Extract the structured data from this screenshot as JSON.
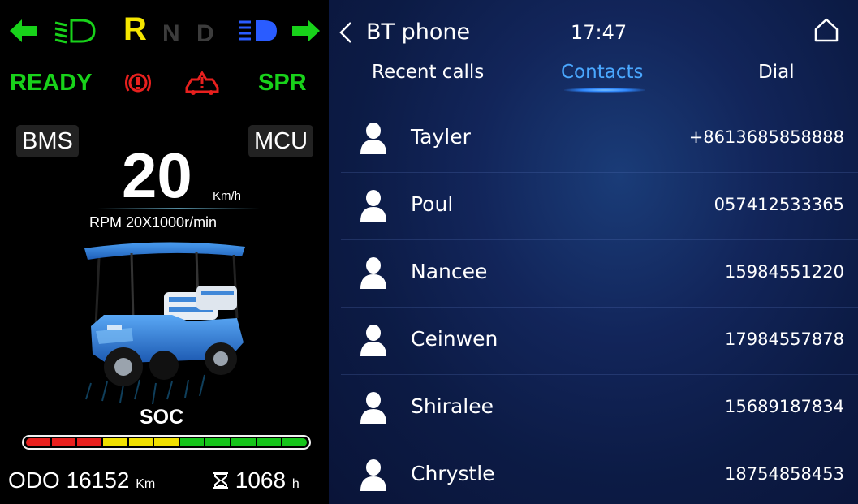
{
  "cluster": {
    "gears": {
      "r": "R",
      "n": "N",
      "d": "D"
    },
    "status": {
      "ready": "READY",
      "spr": "SPR"
    },
    "tags": {
      "bms": "BMS",
      "mcu": "MCU"
    },
    "speed": {
      "value": "20",
      "unit": "Km/h"
    },
    "rpm": "RPM 20X1000r/min",
    "soc": {
      "label": "SOC",
      "segment_colors": [
        "#e8201e",
        "#e8201e",
        "#e8201e",
        "#f0e000",
        "#f0e000",
        "#f0e000",
        "#16c41a",
        "#16c41a",
        "#16c41a",
        "#16c41a",
        "#16c41a"
      ]
    },
    "odo": {
      "label": "ODO",
      "value": "16152",
      "unit": "Km"
    },
    "hours": {
      "value": "1068",
      "unit": "h"
    },
    "icons": {
      "left_turn": "left-turn-arrow-icon",
      "low_beam": "low-beam-icon",
      "high_beam": "high-beam-icon",
      "right_turn": "right-turn-arrow-icon",
      "parking_brake": "parking-brake-icon",
      "warning": "vehicle-warning-icon",
      "hourglass": "hourglass-icon"
    },
    "colors": {
      "green": "#18d21a",
      "yellow": "#f5e600",
      "blue": "#2a5cff",
      "red": "#e8201e"
    }
  },
  "phone": {
    "title": "BT phone",
    "clock": "17:47",
    "tabs": {
      "recent": "Recent calls",
      "contacts": "Contacts",
      "dial": "Dial"
    },
    "active_tab": "Contacts",
    "contacts": [
      {
        "name": "Tayler",
        "number": "+8613685858888"
      },
      {
        "name": "Poul",
        "number": "057412533365"
      },
      {
        "name": "Nancee",
        "number": "15984551220"
      },
      {
        "name": "Ceinwen",
        "number": "17984557878"
      },
      {
        "name": "Shiralee",
        "number": "15689187834"
      },
      {
        "name": "Chrystle",
        "number": "18754858453"
      }
    ],
    "accent": "#4aa8ff"
  }
}
